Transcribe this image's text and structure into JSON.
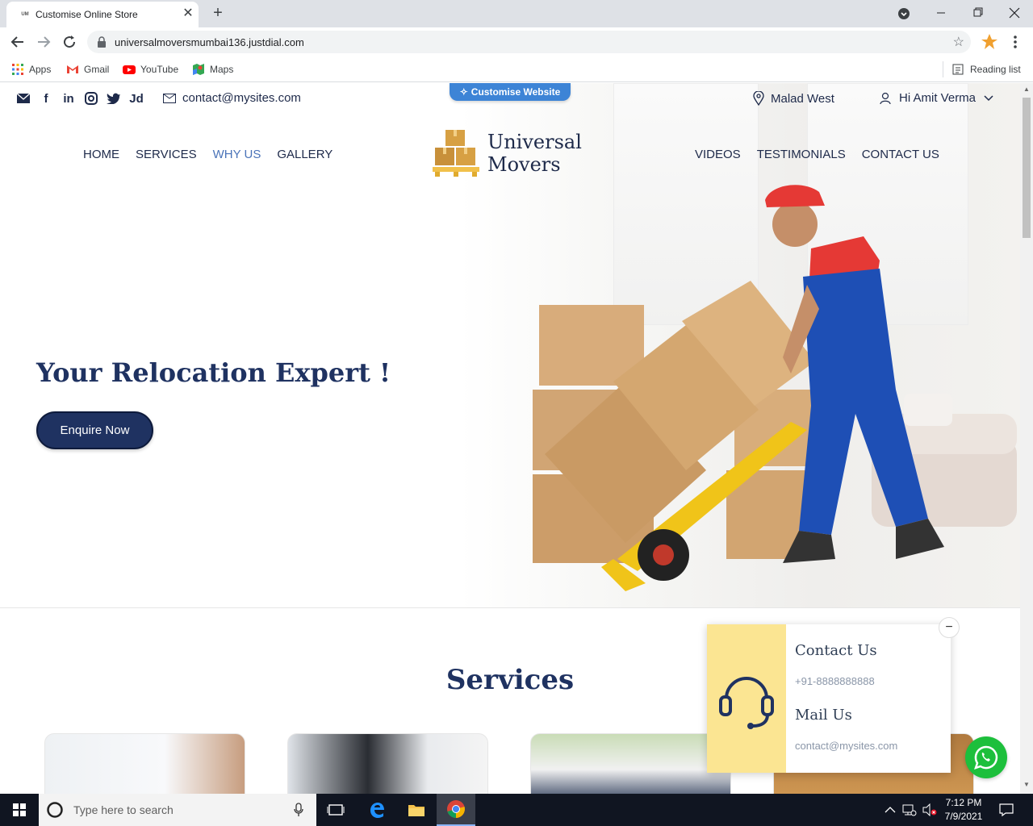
{
  "browser": {
    "tab_title": "Customise Online Store",
    "tab_favicon_text": "UM",
    "url": "universalmoversmumbai136.justdial.com",
    "bookmarks": [
      "Apps",
      "Gmail",
      "YouTube",
      "Maps"
    ],
    "reading_list": "Reading list"
  },
  "site": {
    "email": "contact@mysites.com",
    "customise_label": "Customise Website",
    "location": "Malad West",
    "user_greeting": "Hi Amit Verma",
    "jd_label": "Jd",
    "nav_left": [
      "HOME",
      "SERVICES",
      "WHY US",
      "GALLERY"
    ],
    "nav_right": [
      "VIDEOS",
      "TESTIMONIALS",
      "CONTACT US"
    ],
    "active_nav": "WHY US",
    "logo_line1": "Universal",
    "logo_line2": "Movers",
    "headline": "Your Relocation Expert !",
    "cta": "Enquire Now",
    "services_title": "Services"
  },
  "contact_widget": {
    "contact_title": "Contact Us",
    "phone": "+91-8888888888",
    "mail_title": "Mail Us",
    "mail": "contact@mysites.com",
    "minimize": "−"
  },
  "taskbar": {
    "search_placeholder": "Type here to search",
    "time": "7:12 PM",
    "date": "7/9/2021"
  },
  "colors": {
    "navy": "#1f3261",
    "accent_blue": "#3d84d6",
    "widget_yellow": "#fbe592",
    "whatsapp_green": "#1dbf3c"
  }
}
